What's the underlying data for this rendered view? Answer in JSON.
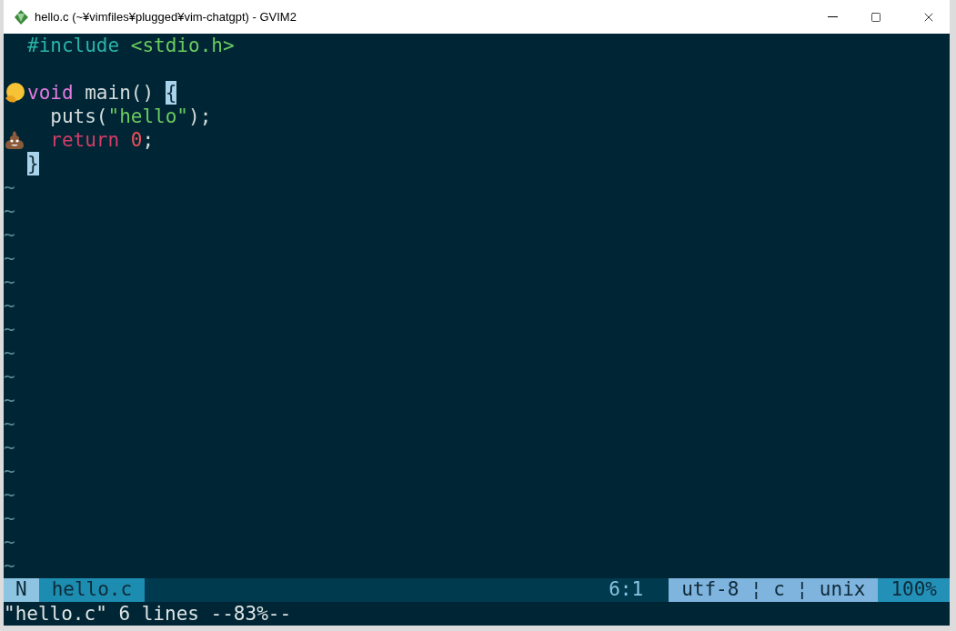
{
  "window": {
    "title": "hello.c (~¥vimfiles¥plugged¥vim-chatgpt) - GVIM2"
  },
  "lines": [
    {
      "kind": "code",
      "tokens": [
        {
          "text": "#include ",
          "kind": "preproc"
        },
        {
          "text": "<stdio.h>",
          "kind": "string"
        }
      ]
    },
    {
      "kind": "blank"
    },
    {
      "kind": "code",
      "sign": {
        "kind": "thinking"
      },
      "tokens": [
        {
          "text": "void",
          "kind": "type"
        },
        {
          "text": " main() ",
          "kind": "plain"
        },
        {
          "text": "{",
          "kind": "match"
        }
      ]
    },
    {
      "kind": "code",
      "tokens": [
        {
          "text": "  puts(",
          "kind": "plain"
        },
        {
          "text": "\"hello\"",
          "kind": "string"
        },
        {
          "text": ");",
          "kind": "plain"
        }
      ]
    },
    {
      "kind": "code",
      "sign": {
        "kind": "poop"
      },
      "tokens": [
        {
          "text": "  return ",
          "kind": "keyword"
        },
        {
          "text": "0",
          "kind": "number"
        },
        {
          "text": ";",
          "kind": "plain"
        }
      ]
    },
    {
      "kind": "code",
      "tokens": [
        {
          "text": "}",
          "kind": "match"
        }
      ]
    }
  ],
  "filler": [
    "~",
    "~",
    "~",
    "~",
    "~",
    "~",
    "~",
    "~",
    "~",
    "~",
    "~",
    "~",
    "~",
    "~",
    "~",
    "~",
    "~"
  ],
  "status_line": {
    "mode": "N",
    "file": "hello.c",
    "position": "6:1",
    "file_info": "utf-8 ¦ c ¦ unix",
    "percent": "100%"
  },
  "command_line": "\"hello.c\" 6 lines --83%--"
}
